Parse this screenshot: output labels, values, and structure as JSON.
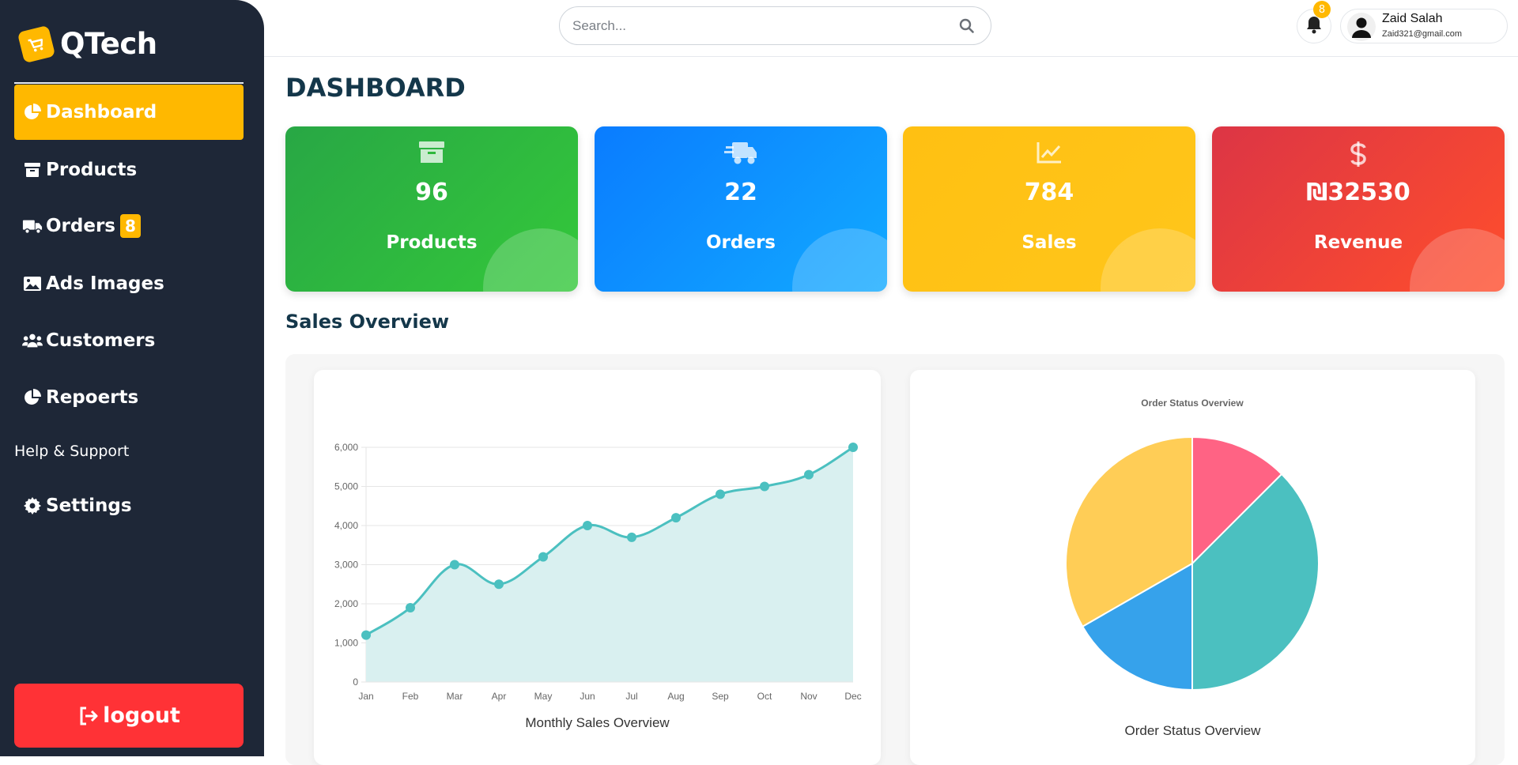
{
  "brand": {
    "name": "QTech",
    "logo_icon": "cart-icon",
    "accent": "#ffb800"
  },
  "sidebar": {
    "items": [
      {
        "label": "Dashboard",
        "icon": "pie-chart-icon",
        "active": true
      },
      {
        "label": "Products",
        "icon": "archive-box-icon"
      },
      {
        "label": "Orders",
        "icon": "truck-icon",
        "badge": "8"
      },
      {
        "label": "Ads Images",
        "icon": "image-icon"
      },
      {
        "label": "Customers",
        "icon": "users-icon"
      },
      {
        "label": "Repoerts",
        "icon": "pie-chart-icon"
      },
      {
        "label": "Help & Support"
      },
      {
        "label": "Settings",
        "icon": "gear-icon"
      }
    ],
    "logout_label": "logout"
  },
  "header": {
    "search_placeholder": "Search...",
    "notifications_count": "8",
    "user_name": "Zaid Salah",
    "user_email": "Zaid321@gmail.com"
  },
  "page": {
    "title": "DASHBOARD",
    "section_title": "Sales Overview"
  },
  "stats": [
    {
      "value": "96",
      "label": "Products",
      "icon": "archive-box-icon",
      "color": "#28a745"
    },
    {
      "value": "22",
      "label": "Orders",
      "icon": "truck-fast-icon",
      "color": "#0d86ff"
    },
    {
      "value": "784",
      "label": "Sales",
      "icon": "line-chart-icon",
      "color": "#ffc012"
    },
    {
      "value": "₪32530",
      "label": "Revenue",
      "icon": "dollar-icon",
      "color": "#e03a3e"
    }
  ],
  "chart_data": [
    {
      "type": "area",
      "title": "",
      "caption": "Monthly Sales Overview",
      "categories": [
        "Jan",
        "Feb",
        "Mar",
        "Apr",
        "May",
        "Jun",
        "Jul",
        "Aug",
        "Sep",
        "Oct",
        "Nov",
        "Dec"
      ],
      "values": [
        1200,
        1900,
        3000,
        2500,
        3200,
        4000,
        3700,
        4200,
        4800,
        5000,
        5300,
        6000
      ],
      "y_ticks": [
        "0",
        "1,000",
        "2,000",
        "3,000",
        "4,000",
        "5,000",
        "6,000"
      ],
      "ylim": [
        0,
        6000
      ],
      "grid": true,
      "line_color": "#4bc0c0",
      "fill_color": "#d9f0f0"
    },
    {
      "type": "pie",
      "title": "Order Status Overview",
      "caption": "Order Status Overview",
      "slices": [
        {
          "value": 12.5,
          "color": "#ff6384"
        },
        {
          "value": 37.5,
          "color": "#4bc0c0"
        },
        {
          "value": 16.7,
          "color": "#36a2eb"
        },
        {
          "value": 33.3,
          "color": "#ffcd56"
        }
      ]
    }
  ]
}
